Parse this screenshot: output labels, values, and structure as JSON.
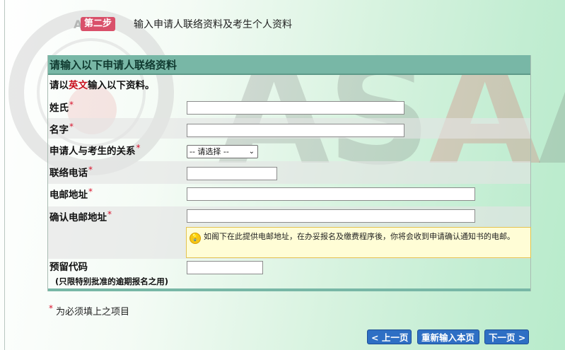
{
  "watermark": {
    "logo_text": "A",
    "letters": [
      "A",
      "S",
      "A",
      "A"
    ]
  },
  "step": {
    "badge": "第二步",
    "title": "输入申请人联络资料及考生个人资料"
  },
  "panel": {
    "title": "请输入以下申请人联络资料",
    "note_prefix": "请以",
    "note_highlight": "英文",
    "note_suffix": "输入以下资料。"
  },
  "fields": {
    "surname": {
      "label": "姓氏",
      "value": ""
    },
    "given_name": {
      "label": "名字",
      "value": ""
    },
    "relationship": {
      "label": "申请人与考生的关系",
      "selected": "-- 请选择 --"
    },
    "phone": {
      "label": "联络电话",
      "value": ""
    },
    "email": {
      "label": "电邮地址",
      "value": ""
    },
    "confirm_email": {
      "label": "确认电邮地址",
      "value": ""
    },
    "reserve_code": {
      "label": "预留代码",
      "sublabel": "(只限特别批准的逾期报名之用)",
      "value": ""
    }
  },
  "required_mark": "*",
  "tip": {
    "icon": "lightbulb-icon",
    "text": "如阁下在此提供电邮地址，在办妥报名及缴费程序後，你将会收到申请确认通知书的电邮。"
  },
  "footnote": "为必须填上之项目",
  "buttons": {
    "prev": "< 上一页",
    "reset": "重新输入本页",
    "next": "下一页 >"
  },
  "colors": {
    "header": "#78b7a6",
    "button": "#2e6fc4",
    "required": "#d8102a",
    "tip_bg": "#fffdd6"
  }
}
